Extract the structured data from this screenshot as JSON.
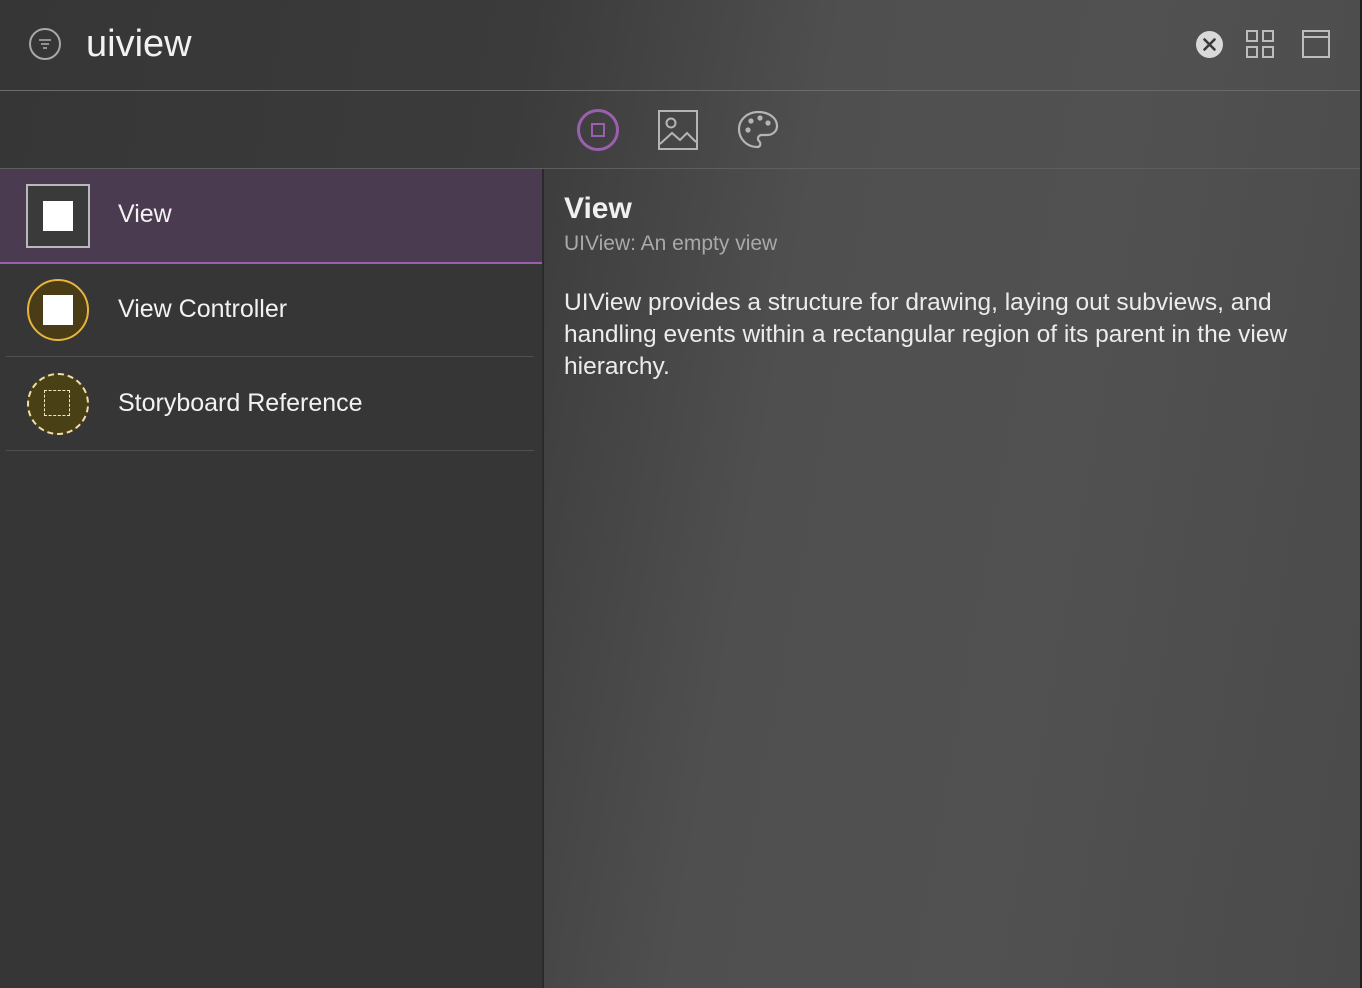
{
  "search": {
    "value": "uiview",
    "filter_icon": "filter-icon",
    "clear_icon": "clear-icon",
    "grid_icon": "grid-view-icon",
    "panel_icon": "window-panel-icon"
  },
  "tabs": [
    {
      "name": "objects",
      "icon": "object-library-icon",
      "selected": true
    },
    {
      "name": "media",
      "icon": "media-library-icon",
      "selected": false
    },
    {
      "name": "colors",
      "icon": "color-palette-icon",
      "selected": false
    }
  ],
  "results": [
    {
      "label": "View",
      "icon": "view-icon",
      "selected": true
    },
    {
      "label": "View Controller",
      "icon": "view-controller-icon",
      "selected": false
    },
    {
      "label": "Storyboard Reference",
      "icon": "storyboard-reference-icon",
      "selected": false
    }
  ],
  "detail": {
    "title": "View",
    "subtitle": "UIView: An empty view",
    "description": "UIView provides a structure for drawing, laying out subviews, and handling events within a rectangular region of its parent in the view hierarchy."
  },
  "colors": {
    "accent": "#9b5fb0",
    "selected_row": "#4b3b50",
    "view_controller": "#e6b43c"
  }
}
